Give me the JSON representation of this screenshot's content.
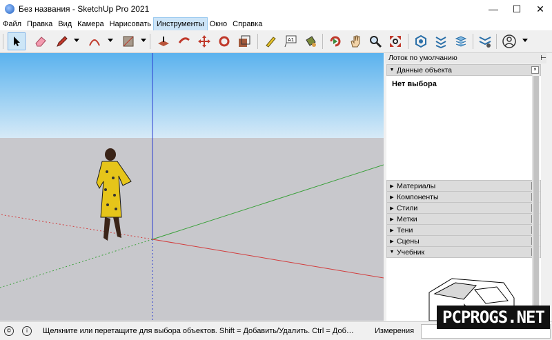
{
  "window": {
    "title": "Без названия - SketchUp Pro 2021",
    "minimize": "—",
    "maximize": "☐",
    "close": "✕"
  },
  "menu": [
    "Файл",
    "Правка",
    "Вид",
    "Камера",
    "Нарисовать",
    "Инструменты",
    "Окно",
    "Справка"
  ],
  "menu_active": "Инструменты",
  "toolbar_icons": [
    "select-icon",
    "eraser-icon",
    "pencil-icon",
    "arc-icon",
    "shape-icon",
    "push-pull-icon",
    "follow-me-icon",
    "move-icon",
    "rotate-icon",
    "scale-icon",
    "tape-measure-icon",
    "text-icon",
    "paint-bucket-icon",
    "orbit-icon",
    "pan-icon",
    "zoom-icon",
    "zoom-extents-icon",
    "warehouse-icon",
    "extension-icon",
    "layout-icon",
    "send-to-layout-icon",
    "profile-icon"
  ],
  "tray": {
    "title": "Лоток по умолчанию",
    "entity_info": {
      "label": "Данные объекта",
      "body": "Нет выбора"
    },
    "panels": [
      "Материалы",
      "Компоненты",
      "Стили",
      "Метки",
      "Тени",
      "Сцены"
    ],
    "instructor": "Учебник"
  },
  "status": {
    "message": "Щелкните или перетащите для выбора объектов. Shift = Добавить/Удалить. Ctrl = Доб…",
    "measure_label": "Измерения"
  },
  "watermark": "PCPROGS.NET",
  "colors": {
    "sky_top": "#5ab2ee",
    "ground": "#c8c8cc",
    "axis_red": "#d23c3c",
    "axis_green": "#3aa03a",
    "axis_blue": "#2a3bd0",
    "accent": "#cce4f7"
  }
}
